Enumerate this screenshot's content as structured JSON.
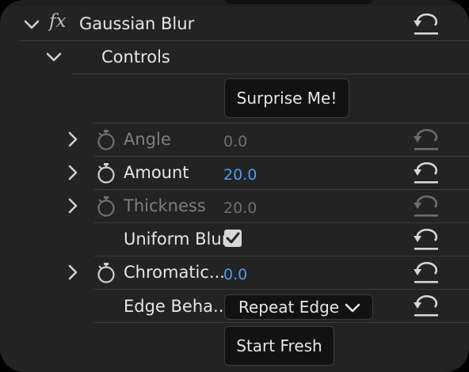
{
  "effect": {
    "fx_label": "fx",
    "name": "Gaussian Blur"
  },
  "controls": {
    "label": "Controls",
    "surprise_button": "Surprise Me!",
    "start_fresh_button": "Start Fresh"
  },
  "params": {
    "angle": {
      "label": "Angle",
      "value": "0.0"
    },
    "amount": {
      "label": "Amount",
      "value": "20.0"
    },
    "thickness": {
      "label": "Thickness",
      "value": "20.0"
    },
    "uniform_blur": {
      "label": "Uniform Blur",
      "checked": true
    },
    "chromatic": {
      "label": "Chromatic...",
      "value": "0.0"
    },
    "edge": {
      "label": "Edge Beha...",
      "value": "Repeat Edge"
    }
  },
  "colors": {
    "accent_value": "#4a9cf0",
    "background": "#232323",
    "disabled_text": "#7e7e7e"
  },
  "icons": [
    "chevron-down-icon",
    "fx-icon",
    "reset-icon",
    "chevron-right-icon",
    "stopwatch-icon",
    "checkmark-icon"
  ]
}
